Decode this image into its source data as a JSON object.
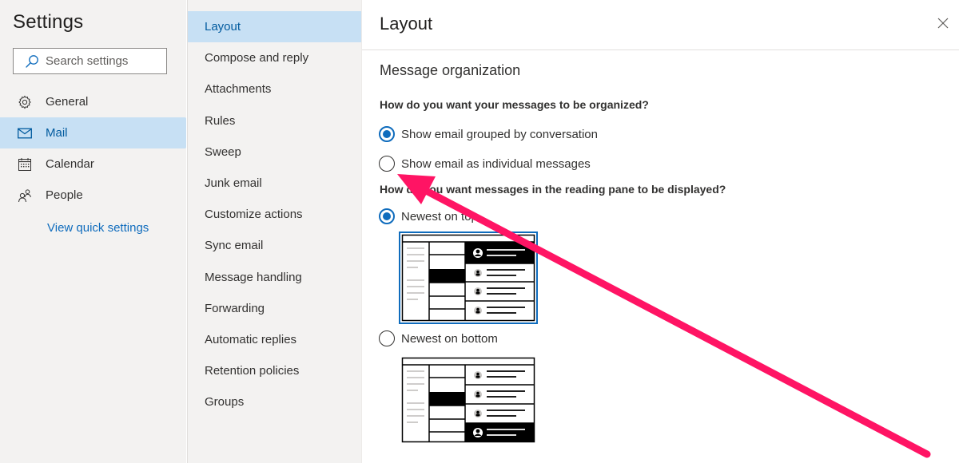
{
  "left_pane": {
    "title": "Settings",
    "search": {
      "placeholder": "Search settings",
      "value": "",
      "icon": "search-icon"
    },
    "nav_items": [
      {
        "label": "General",
        "icon": "gear-icon",
        "selected": false
      },
      {
        "label": "Mail",
        "icon": "mail-icon",
        "selected": true
      },
      {
        "label": "Calendar",
        "icon": "calendar-icon",
        "selected": false
      },
      {
        "label": "People",
        "icon": "people-icon",
        "selected": false
      }
    ],
    "view_quick_settings": "View quick settings"
  },
  "mid_pane": {
    "items": [
      {
        "label": "Layout",
        "selected": true
      },
      {
        "label": "Compose and reply",
        "selected": false
      },
      {
        "label": "Attachments",
        "selected": false
      },
      {
        "label": "Rules",
        "selected": false
      },
      {
        "label": "Sweep",
        "selected": false
      },
      {
        "label": "Junk email",
        "selected": false
      },
      {
        "label": "Customize actions",
        "selected": false
      },
      {
        "label": "Sync email",
        "selected": false
      },
      {
        "label": "Message handling",
        "selected": false
      },
      {
        "label": "Forwarding",
        "selected": false
      },
      {
        "label": "Automatic replies",
        "selected": false
      },
      {
        "label": "Retention policies",
        "selected": false
      },
      {
        "label": "Groups",
        "selected": false
      }
    ]
  },
  "right_pane": {
    "title": "Layout",
    "close_icon": "close-icon",
    "section_title": "Message organization",
    "organization": {
      "question": "How do you want your messages to be organized?",
      "options": [
        {
          "label": "Show email grouped by conversation",
          "checked": true
        },
        {
          "label": "Show email as individual messages",
          "checked": false
        }
      ]
    },
    "reading_pane": {
      "question": "How do you want messages in the reading pane to be displayed?",
      "options": [
        {
          "label": "Newest on top",
          "checked": true,
          "preview": "newest-on-top-preview"
        },
        {
          "label": "Newest on bottom",
          "checked": false,
          "preview": "newest-on-bottom-preview"
        }
      ]
    }
  },
  "annotation": {
    "type": "arrow",
    "color": "#ff1464",
    "points_to": "Show email as individual messages"
  },
  "colors": {
    "accent": "#0f6cbd",
    "selected_bg": "#c7e0f4",
    "selected_text": "#005a9e",
    "pane_bg": "#f3f2f1"
  }
}
